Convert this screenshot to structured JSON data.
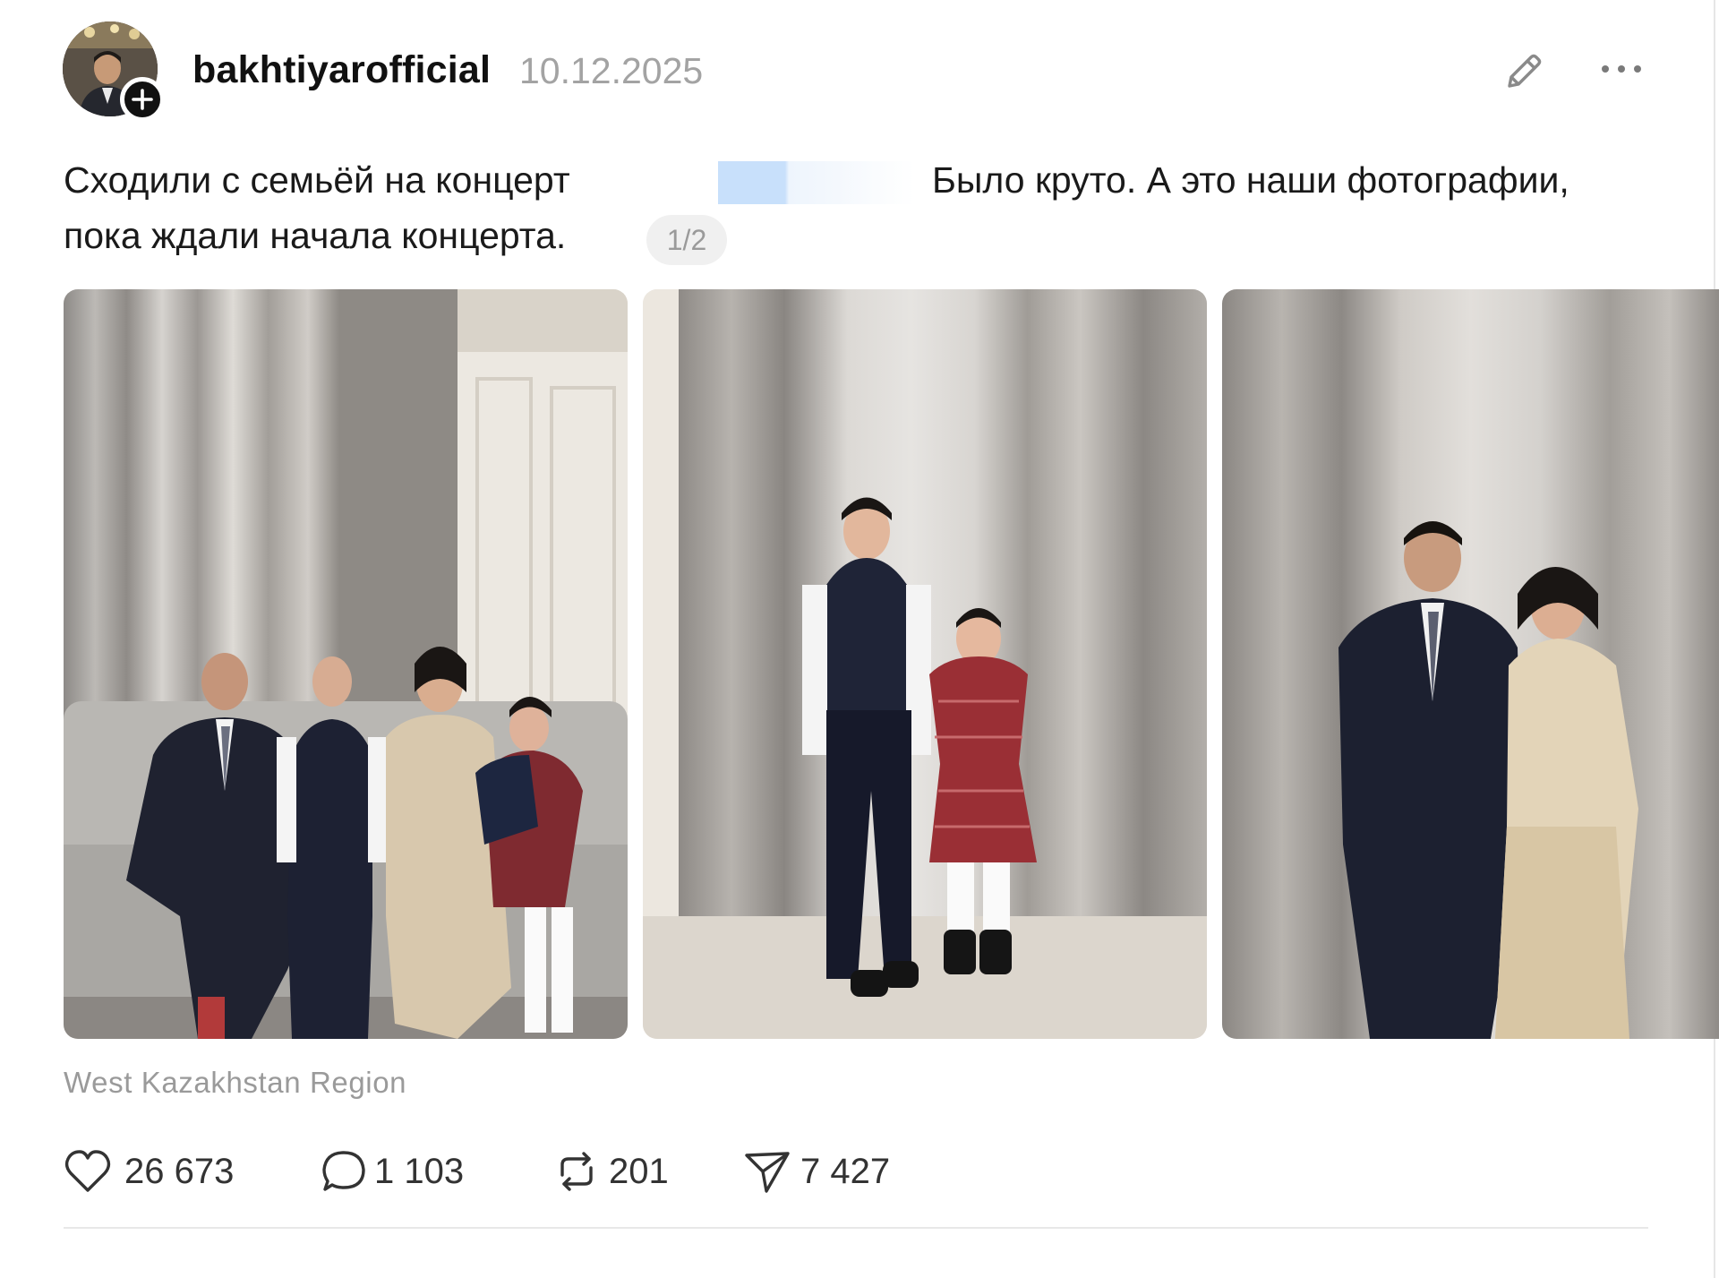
{
  "post": {
    "username": "bakhtiyarofficial",
    "date": "10.12.2025",
    "text_line1_part1": "Сходили с семьёй на концерт",
    "text_line1_part2": "Было круто. А это наши фотографии,",
    "text_line2": "пока ждали начала концерта.",
    "translate_badge": "1/2",
    "location": "West Kazakhstan Region",
    "photos": [
      {
        "label": "family-seated-on-sofa"
      },
      {
        "label": "two-girls-standing"
      },
      {
        "label": "couple-standing"
      }
    ]
  },
  "actions": {
    "likes": "26 673",
    "comments": "1 103",
    "reposts": "201",
    "shares": "7 427"
  },
  "icons": {
    "avatar_add": "plus-icon",
    "edit": "pencil-icon",
    "more": "more-dots-icon",
    "like": "heart-icon",
    "comment": "comment-icon",
    "repost": "repost-icon",
    "share": "send-icon"
  },
  "colors": {
    "text": "#1a1a1a",
    "muted": "#a3a3a3",
    "redaction": "#cfe4fb"
  }
}
